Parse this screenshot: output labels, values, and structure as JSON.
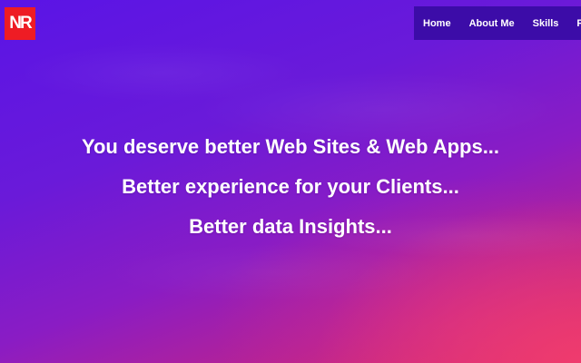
{
  "logo": {
    "text": "NR",
    "color": "#ee1c24"
  },
  "nav": {
    "background": "#3c0ca8",
    "items": [
      {
        "label": "Home"
      },
      {
        "label": "About Me"
      },
      {
        "label": "Skills"
      },
      {
        "label": "Proj"
      }
    ]
  },
  "hero": {
    "lines": [
      "You deserve better Web Sites & Web Apps...",
      "Better experience for your Clients...",
      "Better data Insights..."
    ]
  }
}
